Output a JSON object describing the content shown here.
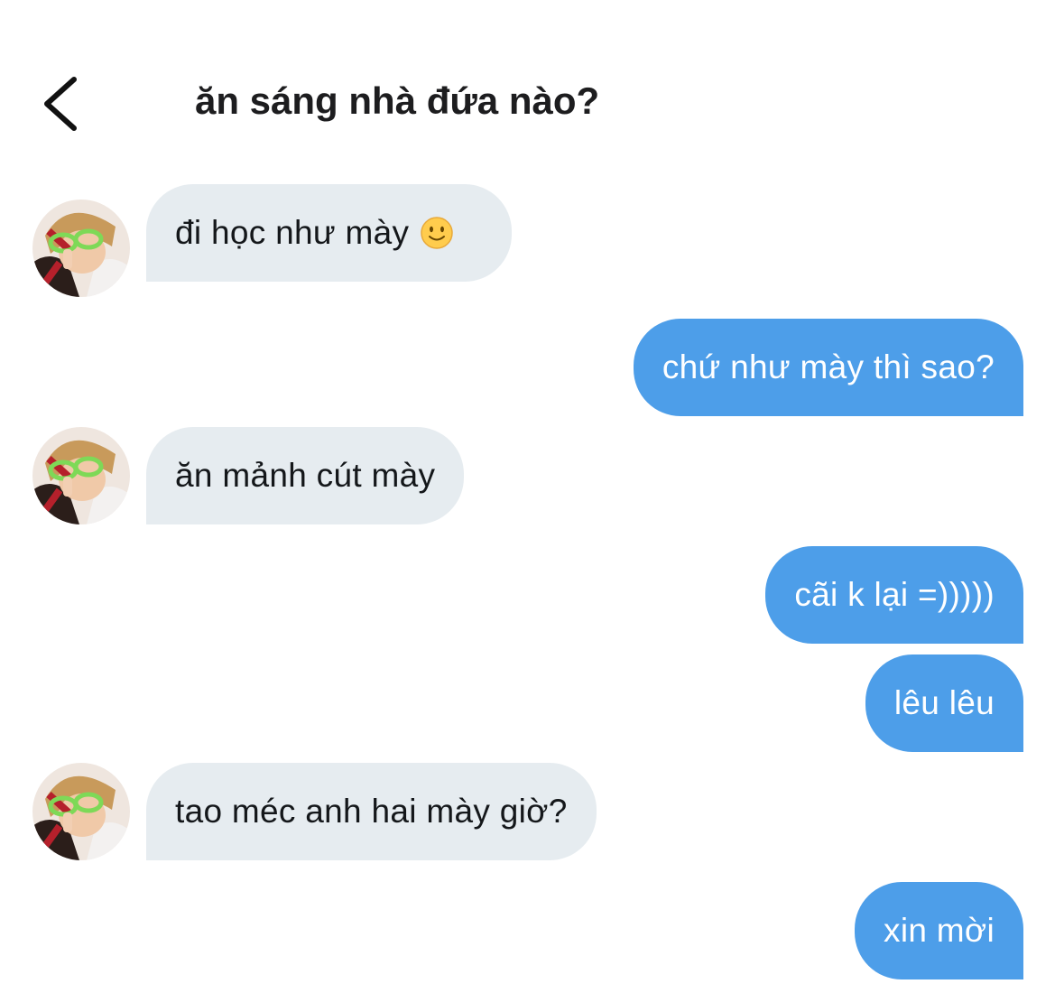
{
  "header": {
    "back_icon": "chevron-left-icon",
    "title": "ăn sáng nhà đứa nào?"
  },
  "messages": [
    {
      "direction": "incoming",
      "text": "đi học như mày",
      "emoji": "slightly-smiling-face"
    },
    {
      "direction": "outgoing",
      "text": "chứ như mày thì sao?"
    },
    {
      "direction": "incoming",
      "text": "ăn mảnh cút mày"
    },
    {
      "direction": "outgoing",
      "text": "cãi k lại =)))))"
    },
    {
      "direction": "outgoing",
      "text": "lêu lêu"
    },
    {
      "direction": "incoming",
      "text": "tao méc anh hai mày giờ?"
    },
    {
      "direction": "outgoing",
      "text": "xin mời"
    }
  ],
  "colors": {
    "incoming_bubble": "#e6ecf0",
    "outgoing_bubble": "#4d9ee9",
    "incoming_text": "#14171a",
    "outgoing_text": "#ffffff"
  }
}
